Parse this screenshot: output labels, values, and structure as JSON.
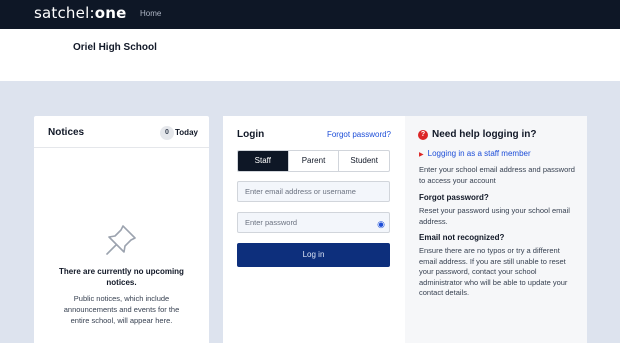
{
  "header": {
    "logo_text_light": "satchel:",
    "logo_text_bold": "one",
    "nav_home": "Home"
  },
  "school": {
    "name": "Oriel High School"
  },
  "notices": {
    "title": "Notices",
    "count": "0",
    "filter": "Today",
    "empty_title": "There are currently no upcoming notices.",
    "empty_body": "Public notices, which include announcements and events for the entire school, will appear here."
  },
  "login": {
    "title": "Login",
    "forgot_link": "Forgot password?",
    "roles": [
      "Staff",
      "Parent",
      "Student"
    ],
    "active_role": "Staff",
    "email_placeholder": "Enter email address or username",
    "password_placeholder": "Enter password",
    "submit_label": "Log in"
  },
  "help": {
    "title": "Need help logging in?",
    "staff_link": "Logging in as a staff member",
    "intro": "Enter your school email address and password to access your account",
    "forgot_heading": "Forgot password?",
    "forgot_body": "Reset your password using your school email address.",
    "email_heading": "Email not recognized?",
    "email_body": "Ensure there are no typos or try a different email address. If you are still unable to reset your password, contact your school administrator who will be able to update your contact details."
  },
  "colors": {
    "topbar": "#0e1726",
    "page_bg": "#dde3ee",
    "primary_button": "#0d2f7c",
    "link": "#1d4ed8",
    "help_icon": "#dc2626"
  },
  "icons": {
    "notices_empty": "pushpin-icon",
    "password_toggle": "eye-icon",
    "help": "question-circle-icon",
    "link_bullet": "triangle-right-icon"
  }
}
